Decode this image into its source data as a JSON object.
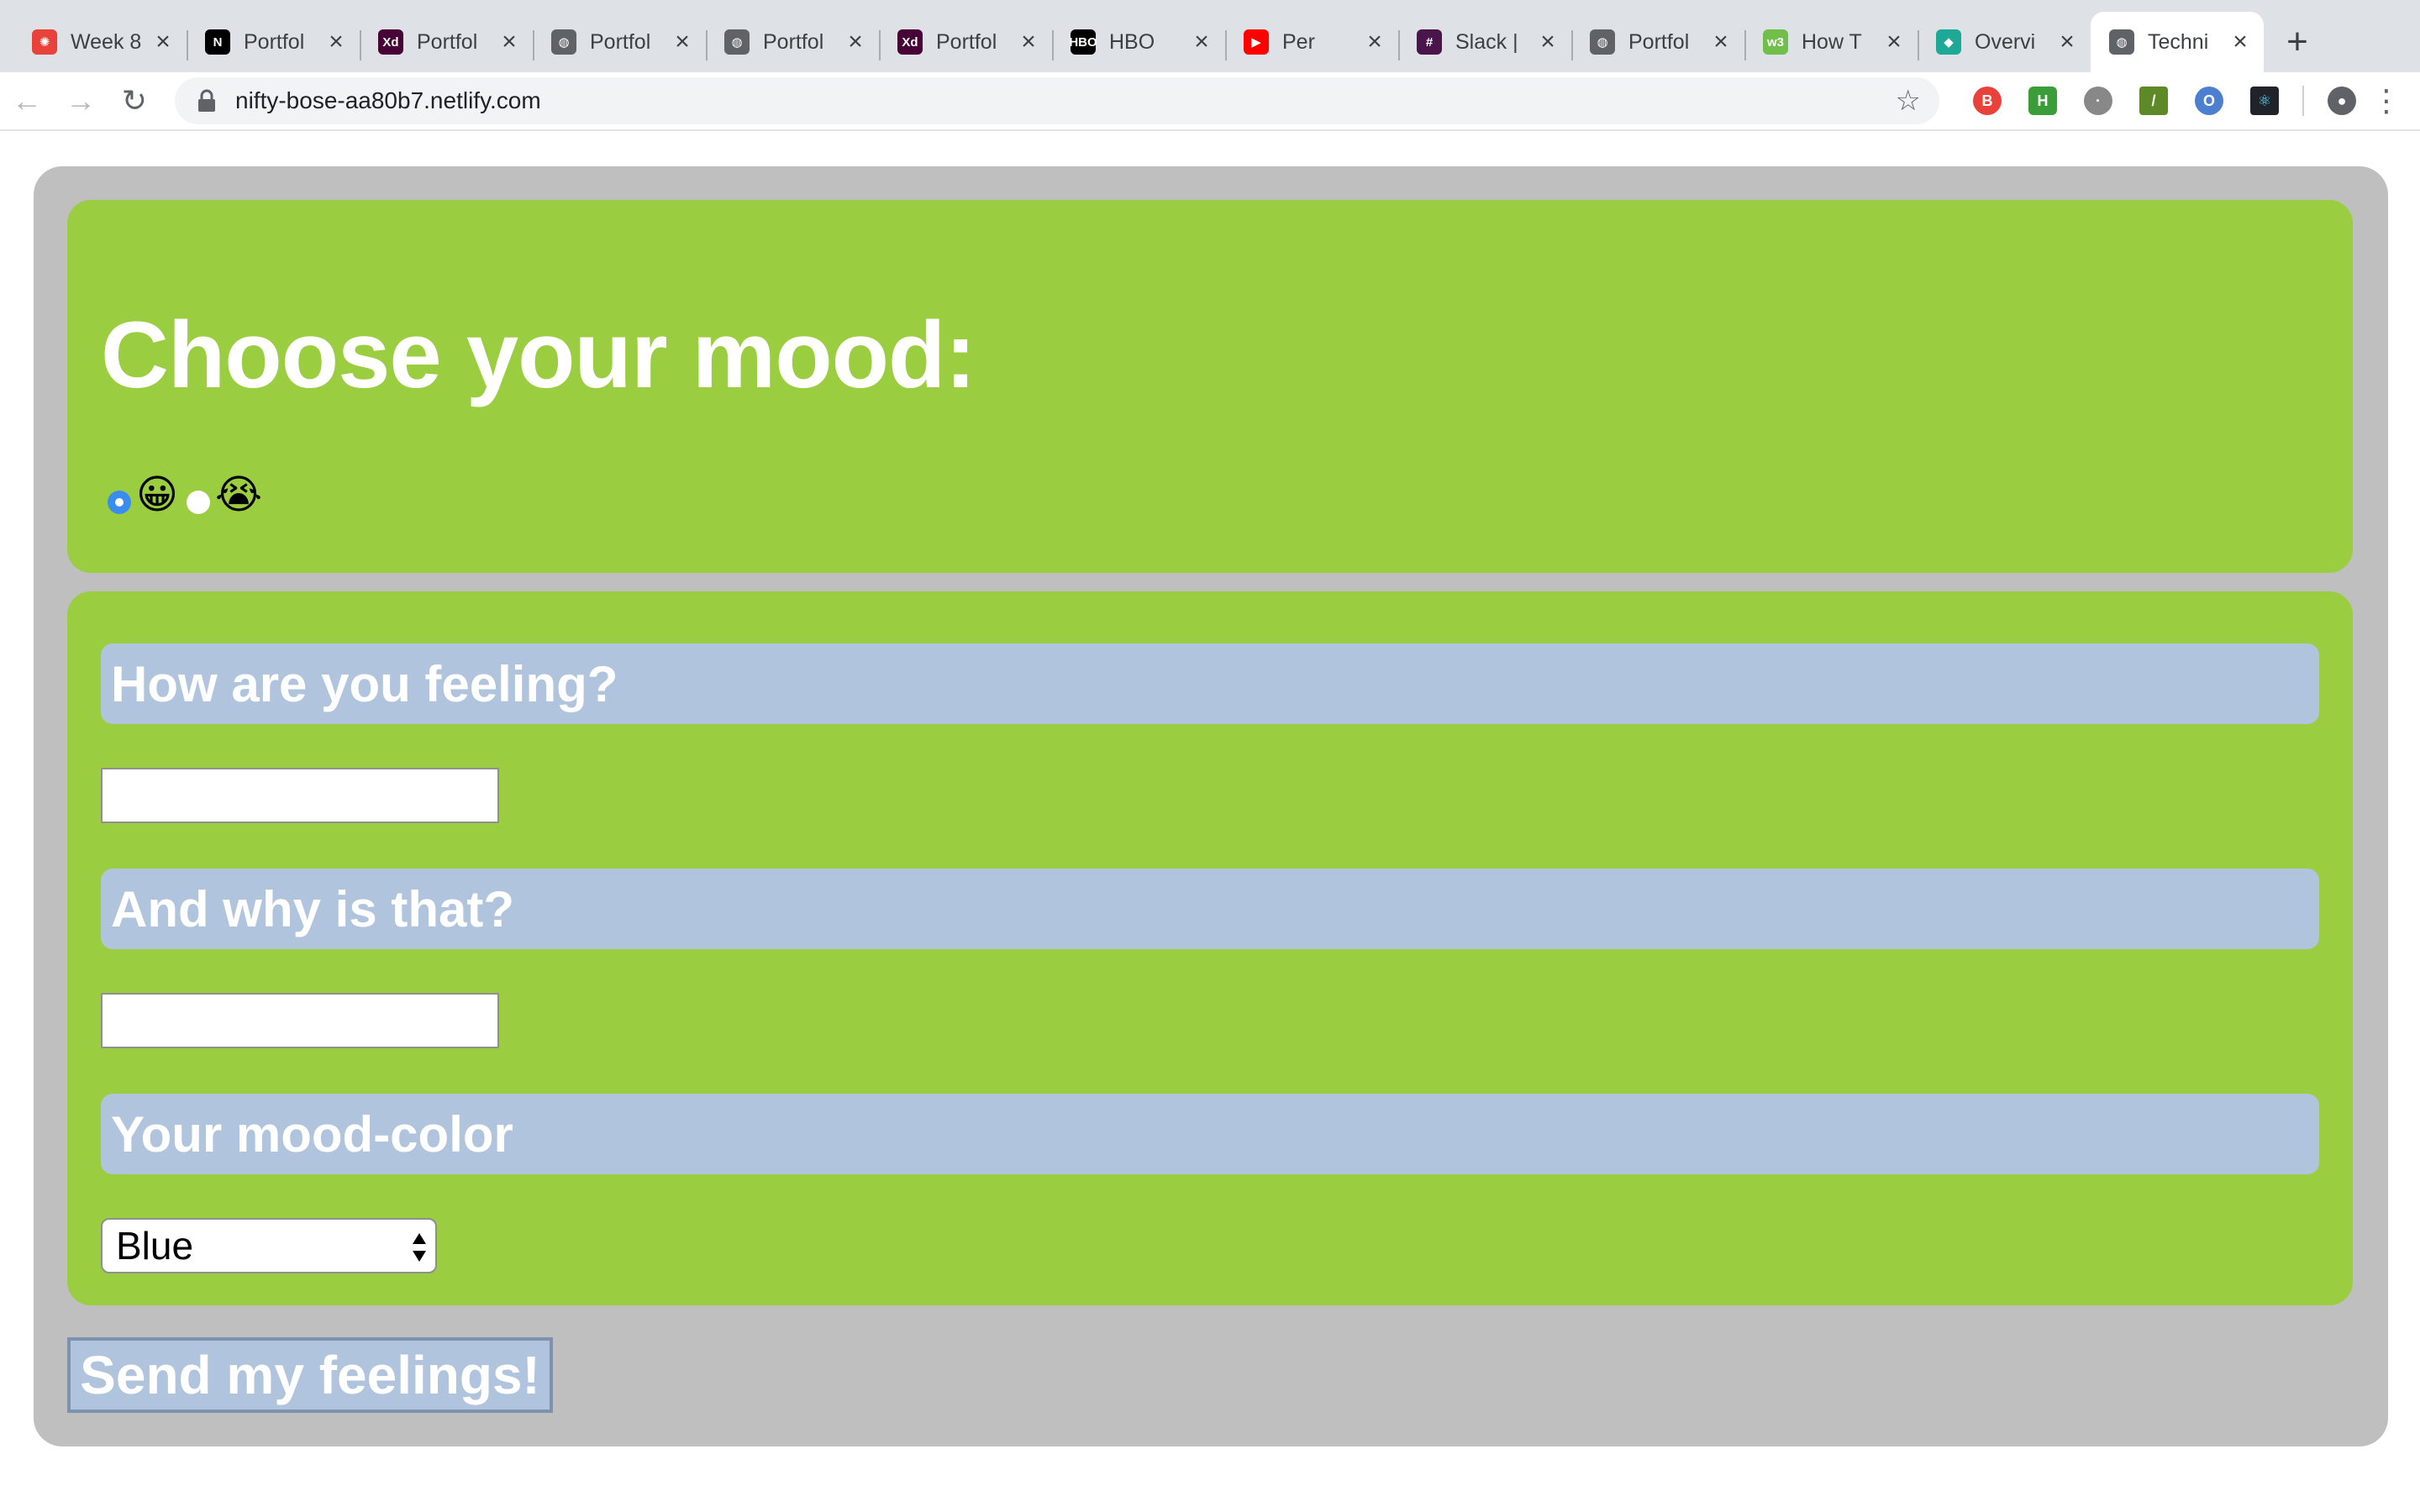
{
  "browser": {
    "tabs": [
      {
        "title": "Week 8",
        "icon": "settings-icon",
        "color": "#e8423a"
      },
      {
        "title": "Portfol",
        "icon": "notion-icon",
        "color": "#000000"
      },
      {
        "title": "Portfol",
        "icon": "xd-icon",
        "color": "#470137"
      },
      {
        "title": "Portfol",
        "icon": "globe-icon",
        "color": "#5f6368"
      },
      {
        "title": "Portfol",
        "icon": "globe-icon",
        "color": "#5f6368"
      },
      {
        "title": "Portfol",
        "icon": "xd-icon",
        "color": "#470137"
      },
      {
        "title": "HBO",
        "icon": "hbo-icon",
        "color": "#000000"
      },
      {
        "title": "Per",
        "icon": "youtube-icon",
        "color": "#ff0000"
      },
      {
        "title": "Slack |",
        "icon": "slack-icon",
        "color": "#4a154b"
      },
      {
        "title": "Portfol",
        "icon": "globe-icon",
        "color": "#5f6368"
      },
      {
        "title": "How T",
        "icon": "w3-icon",
        "color": "#6fbf4a"
      },
      {
        "title": "Overvi",
        "icon": "diamond-icon",
        "color": "#1ea896"
      },
      {
        "title": "Techni",
        "icon": "globe-icon",
        "color": "#5f6368",
        "active": true
      }
    ],
    "new_tab": "+",
    "url": "nifty-bose-aa80b7.netlify.com"
  },
  "mood": {
    "title": "Choose your mood:",
    "options": [
      {
        "emoji": "😀",
        "checked": true
      },
      {
        "emoji": "😭",
        "checked": false
      }
    ]
  },
  "form": {
    "q1": "How are you feeling?",
    "q1_value": "",
    "q2": "And why is that?",
    "q2_value": "",
    "q3": "Your mood-color",
    "color_selected": "Blue"
  },
  "send_label": "Send my feelings!",
  "colors": {
    "outer": "#bfbfbf",
    "panel": "#9acd3f",
    "bar": "#b0c4de"
  }
}
